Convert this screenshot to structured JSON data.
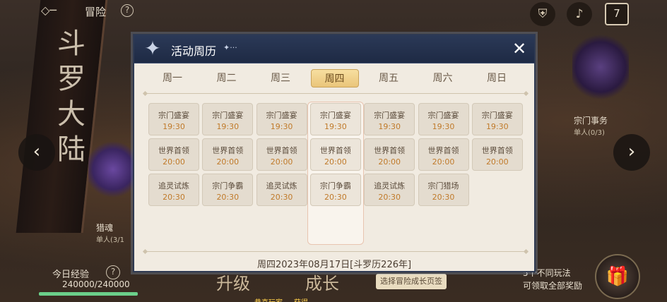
{
  "topbar": {
    "title": "冒险",
    "help": "?",
    "calendar_day": "7"
  },
  "background": {
    "banner_text": "斗罗大陆"
  },
  "side_left": {
    "label": "猎魂",
    "sub": "单人(3/1"
  },
  "side_right": {
    "label": "宗门事务",
    "sub": "单人(0/3)"
  },
  "nav": {
    "prev": "‹",
    "next": "›"
  },
  "exp": {
    "label": "今日经验",
    "help": "?",
    "value": "240000/240000",
    "progress": 1.0
  },
  "bottom": {
    "tab_upgrade": "升级",
    "tab_growth": "成长",
    "growth_button": "选择冒险成长页签",
    "right_text_line1": "5个不同玩法",
    "right_text_line2": "可领取全部奖励",
    "marquee": "恭喜玩家 ... 获得 ..."
  },
  "modal": {
    "title": "活动周历",
    "title_deco": "✦···",
    "close": "✕",
    "days": [
      "周一",
      "周二",
      "周三",
      "周四",
      "周五",
      "周六",
      "周日"
    ],
    "active_day_index": 3,
    "schedule": [
      [
        {
          "name": "宗门盛宴",
          "time": "19:30"
        },
        {
          "name": "世界首领",
          "time": "20:00"
        },
        {
          "name": "追灵试炼",
          "time": "20:30"
        }
      ],
      [
        {
          "name": "宗门盛宴",
          "time": "19:30"
        },
        {
          "name": "世界首领",
          "time": "20:00"
        },
        {
          "name": "宗门争霸",
          "time": "20:30"
        }
      ],
      [
        {
          "name": "宗门盛宴",
          "time": "19:30"
        },
        {
          "name": "世界首领",
          "time": "20:00"
        },
        {
          "name": "追灵试炼",
          "time": "20:30"
        }
      ],
      [
        {
          "name": "宗门盛宴",
          "time": "19:30"
        },
        {
          "name": "世界首领",
          "time": "20:00"
        },
        {
          "name": "宗门争霸",
          "time": "20:30"
        }
      ],
      [
        {
          "name": "宗门盛宴",
          "time": "19:30"
        },
        {
          "name": "世界首领",
          "time": "20:00"
        },
        {
          "name": "追灵试炼",
          "time": "20:30"
        }
      ],
      [
        {
          "name": "宗门盛宴",
          "time": "19:30"
        },
        {
          "name": "世界首领",
          "time": "20:00"
        },
        {
          "name": "宗门猎场",
          "time": "20:30"
        }
      ],
      [
        {
          "name": "宗门盛宴",
          "time": "19:30"
        },
        {
          "name": "世界首领",
          "time": "20:00"
        }
      ]
    ],
    "footer_date": "周四2023年08月17日[斗罗历226年]"
  },
  "colors": {
    "accent_time": "#c07a2a",
    "header_bg": "#1e2a44",
    "active_day": "#eac57a"
  }
}
